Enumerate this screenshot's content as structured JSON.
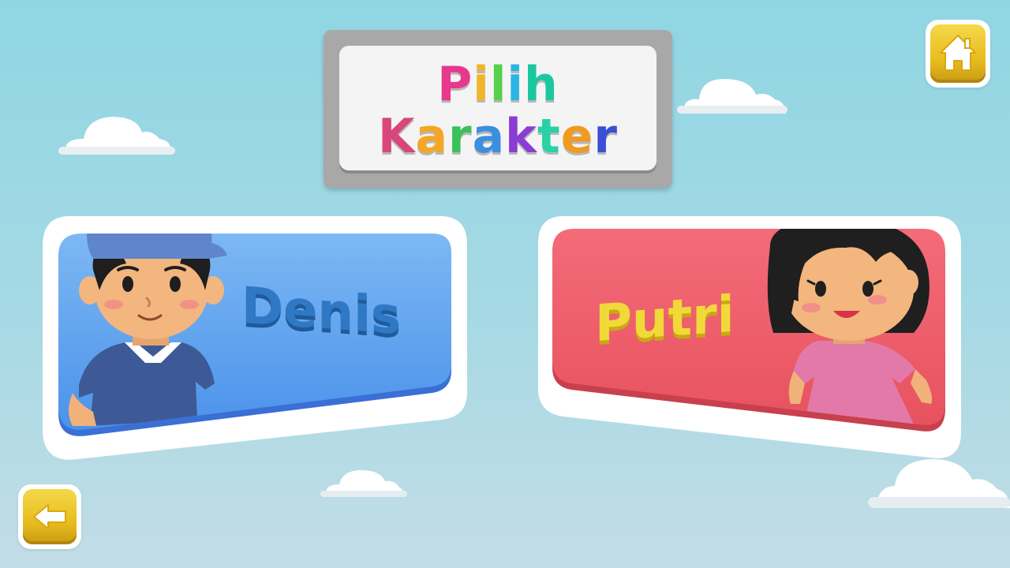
{
  "title": {
    "line1": "Pilih",
    "line2": "Karakter",
    "line1_colors": [
      "#e8388e",
      "#f2b42a",
      "#56d14a",
      "#2bb5e6",
      "#1cc7a0"
    ],
    "line2_colors": [
      "#d8467a",
      "#f5a623",
      "#3cc15a",
      "#3c8fe0",
      "#8b3cd6",
      "#29d1a6",
      "#f09a1f",
      "#3a4fd6"
    ]
  },
  "characters": [
    {
      "name": "Denis",
      "text_color": "#2f78c4",
      "card_color": "#5fa4ee"
    },
    {
      "name": "Putri",
      "text_color": "#f2d93a",
      "card_color": "#ef5e6c"
    }
  ],
  "buttons": {
    "home_icon": "home-icon",
    "back_icon": "arrow-left-icon"
  },
  "colors": {
    "accent_yellow": "#f0cc2e",
    "sky": "#9ad7e4"
  }
}
